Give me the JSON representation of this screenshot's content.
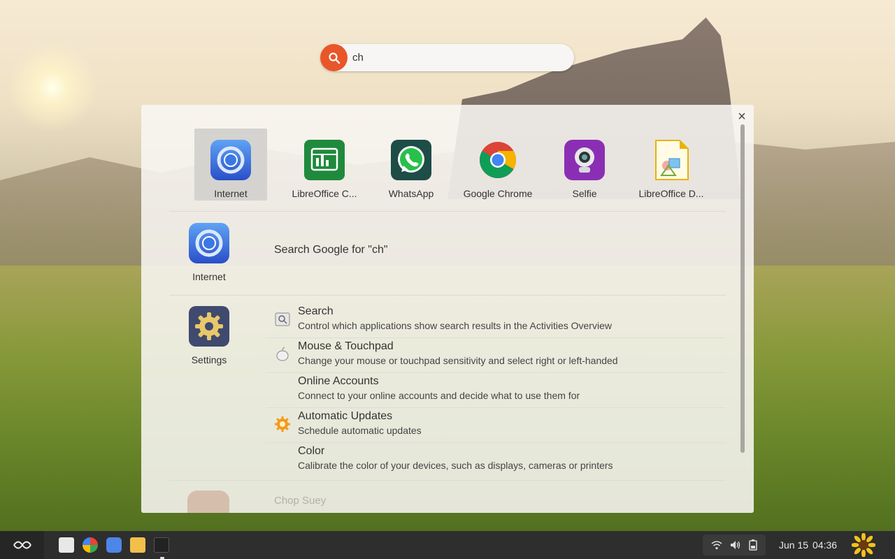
{
  "search": {
    "query": "ch",
    "placeholder": ""
  },
  "panel": {
    "close_label": "×"
  },
  "apps": [
    {
      "name": "Internet",
      "icon": "internet-icon",
      "selected": true
    },
    {
      "name": "LibreOffice C...",
      "icon": "libreoffice-calc-icon",
      "selected": false
    },
    {
      "name": "WhatsApp",
      "icon": "whatsapp-icon",
      "selected": false
    },
    {
      "name": "Google Chrome",
      "icon": "google-chrome-icon",
      "selected": false
    },
    {
      "name": "Selfie",
      "icon": "selfie-icon",
      "selected": false
    },
    {
      "name": "LibreOffice D...",
      "icon": "libreoffice-draw-icon",
      "selected": false
    }
  ],
  "providers": {
    "internet": {
      "label": "Internet",
      "result": "Search Google for \"ch\""
    },
    "settings": {
      "label": "Settings"
    }
  },
  "settings_results": [
    {
      "title": "Search",
      "desc": "Control which applications show search results in the Activities Overview",
      "icon": "search-settings-icon"
    },
    {
      "title": "Mouse & Touchpad",
      "desc": "Change your mouse or touchpad sensitivity and select right or left-handed",
      "icon": "mouse-icon"
    },
    {
      "title": "Online Accounts",
      "desc": "Connect to your online accounts and decide what to use them for",
      "icon": ""
    },
    {
      "title": "Automatic Updates",
      "desc": "Schedule automatic updates",
      "icon": "updates-icon"
    },
    {
      "title": "Color",
      "desc": "Calibrate the color of your devices, such as displays, cameras or printers",
      "icon": ""
    }
  ],
  "faded_result": {
    "label": "Chop Suey"
  },
  "taskbar": {
    "date": "Jun 15",
    "time": "04:36"
  },
  "colors": {
    "accent": "#e9562a",
    "taskbar": "#2e2e2e"
  }
}
